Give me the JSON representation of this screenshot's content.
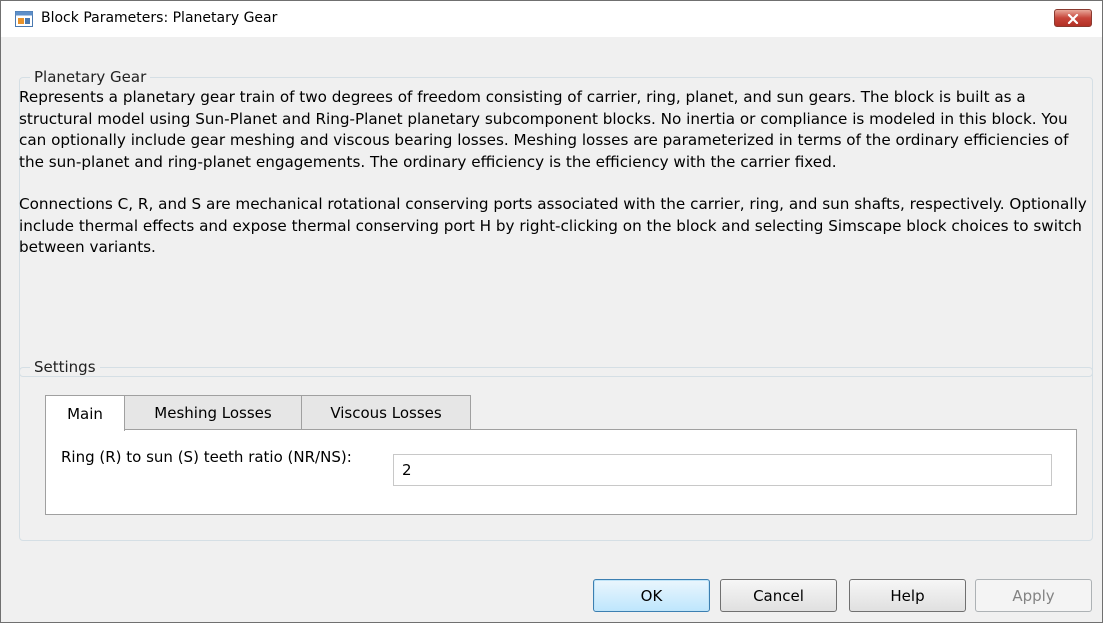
{
  "window": {
    "title": "Block Parameters: Planetary Gear",
    "close_icon": "close-icon"
  },
  "description_group": {
    "title": "Planetary Gear",
    "paragraph1": "Represents a planetary gear train of two degrees of freedom consisting of carrier, ring, planet, and sun gears. The block is built as a structural model using Sun-Planet and Ring-Planet planetary subcomponent blocks. No inertia or compliance is modeled in this block. You can optionally include gear meshing and viscous bearing losses. Meshing losses are parameterized in terms of the ordinary efficiencies of the sun-planet and ring-planet engagements. The ordinary efficiency is the efficiency with the carrier fixed.",
    "paragraph2": "Connections C, R, and S are mechanical rotational conserving ports associated with the carrier, ring, and sun shafts, respectively. Optionally include thermal effects and expose thermal conserving port H by right-clicking on the block and selecting Simscape block choices to switch between variants."
  },
  "settings_group": {
    "title": "Settings",
    "tabs": [
      {
        "label": "Main",
        "active": true
      },
      {
        "label": "Meshing Losses",
        "active": false
      },
      {
        "label": "Viscous Losses",
        "active": false
      }
    ],
    "main": {
      "ratio_label": "Ring (R) to sun (S) teeth ratio (NR/NS):",
      "ratio_value": "2"
    }
  },
  "buttons": {
    "ok": "OK",
    "cancel": "Cancel",
    "help": "Help",
    "apply": "Apply"
  },
  "colors": {
    "close_button": "#c7453a",
    "default_button_border": "#3c7fb1",
    "panel_background": "#f0f0f0"
  }
}
